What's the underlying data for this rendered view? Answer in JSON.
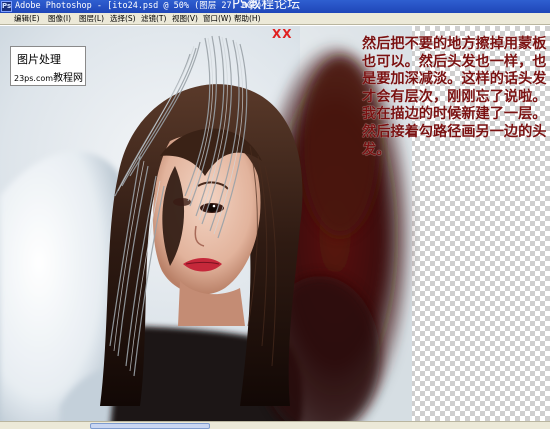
{
  "window": {
    "app_logo": "Ps",
    "title": "Adobe Photoshop - [ito24.psd @ 50% (图层 27, RGB)]",
    "watermark": "PS教程论坛"
  },
  "menubar": {
    "items": [
      {
        "label": "编辑(E)"
      },
      {
        "label": "图像(I)"
      },
      {
        "label": "图层(L)"
      },
      {
        "label": "选择(S)"
      },
      {
        "label": "滤镜(T)"
      },
      {
        "label": "视图(V)"
      },
      {
        "label": "窗口(W)"
      },
      {
        "label": "帮助(H)"
      }
    ]
  },
  "canvas": {
    "logo": {
      "line1": "图片处理",
      "line2_prefix": "23ps.com",
      "line2_suffix": "教程网"
    },
    "mark": "XX",
    "annotation": "然后把不要的地方擦掉用蒙板也可以。然后头发也一样，也是要加深减淡。这样的话头发才会有层次，刚刚忘了说啦。我在描边的时候新建了一层。然后接着勾路径画另一边的头发。"
  },
  "colors": {
    "annotation_text": "#7a1212",
    "title_bar": "#1f46b8",
    "menu_bar": "#ece9d8",
    "mark": "#e02020"
  }
}
